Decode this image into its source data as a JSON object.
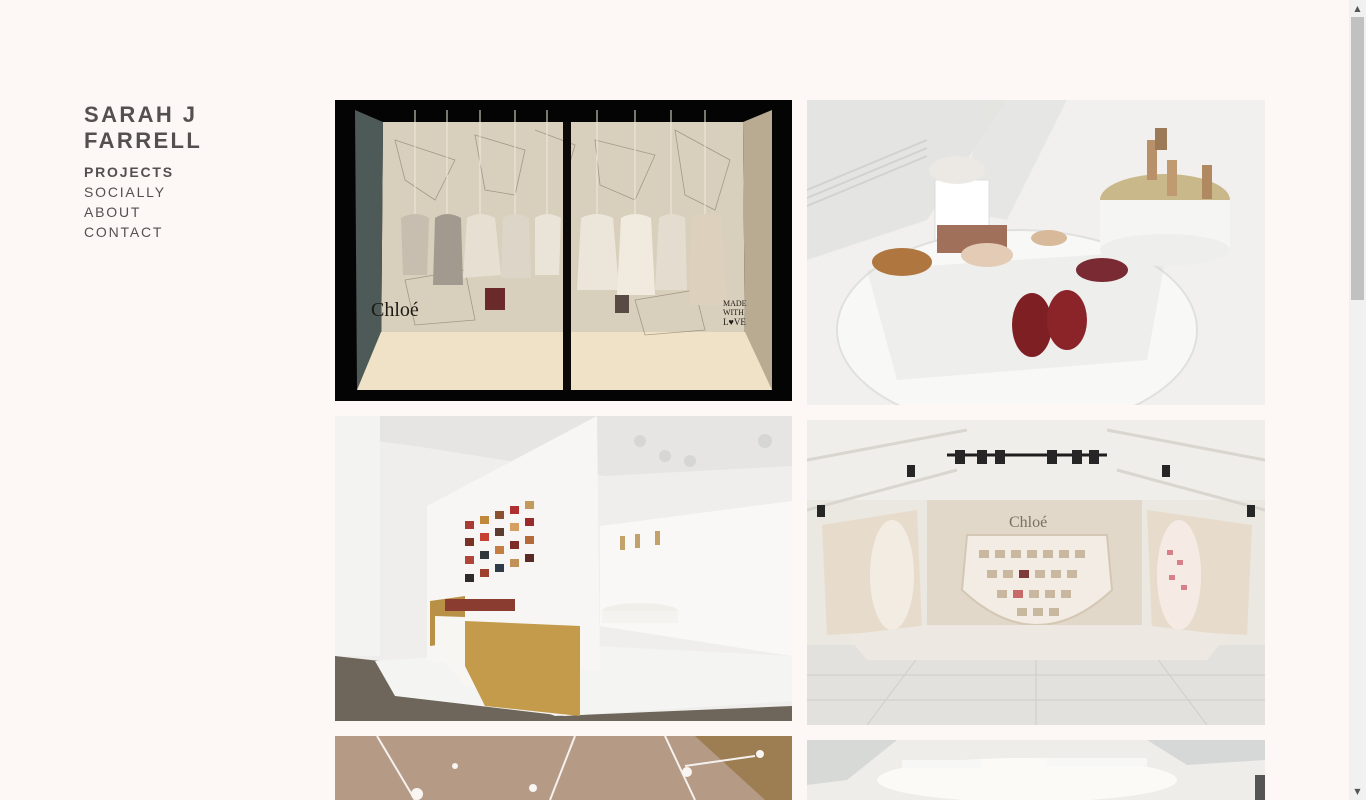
{
  "site": {
    "title": "SARAH J FARRELL"
  },
  "nav": {
    "items": [
      {
        "label": "PROJECTS",
        "active": true
      },
      {
        "label": "SOCIALLY",
        "active": false
      },
      {
        "label": "ABOUT",
        "active": false
      },
      {
        "label": "CONTACT",
        "active": false
      }
    ]
  },
  "gallery": {
    "images": [
      {
        "alt": "Chloé window display with hanging garments",
        "caption_text": [
          "Chloé",
          "MADE",
          "WITH",
          "L♥VE"
        ]
      },
      {
        "alt": "Shoes displayed on white pedestals"
      },
      {
        "alt": "Gallery room with handbag wall and gold counter"
      },
      {
        "alt": "Chloé store installation with handbag display wall",
        "sign_text": "Chloé"
      },
      {
        "alt": "Ceiling with hanging pendant lights"
      },
      {
        "alt": "Bright white interior room"
      }
    ]
  },
  "scrollbar": {
    "up_icon": "triangle-up-icon",
    "down_icon": "triangle-down-icon"
  }
}
